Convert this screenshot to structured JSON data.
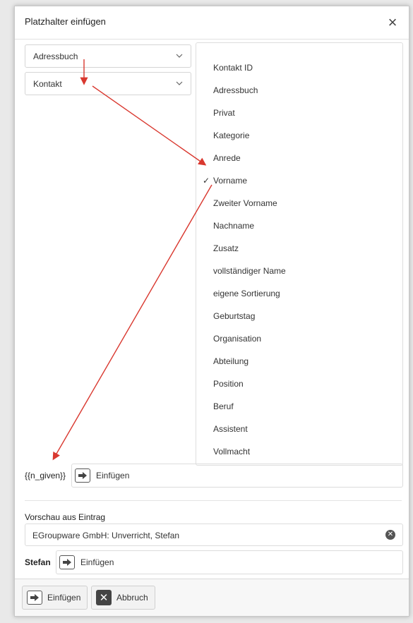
{
  "dialog": {
    "title": "Platzhalter einfügen",
    "close_glyph": "×"
  },
  "selects": {
    "app": "Adressbuch",
    "type": "Kontakt"
  },
  "fields": {
    "selected": "Vorname",
    "check_glyph": "✓",
    "items": [
      "Kontakt ID",
      "Adressbuch",
      "Privat",
      "Kategorie",
      "Anrede",
      "Vorname",
      "Zweiter Vorname",
      "Nachname",
      "Zusatz",
      "vollständiger Name",
      "eigene Sortierung",
      "Geburtstag",
      "Organisation",
      "Abteilung",
      "Position",
      "Beruf",
      "Assistent",
      "Vollmacht"
    ]
  },
  "placeholder": {
    "value": "{{n_given}}",
    "insert_label": "Einfügen"
  },
  "preview": {
    "label": "Vorschau aus Eintrag",
    "entry": "EGroupware GmbH: Unverricht, Stefan",
    "result": "Stefan",
    "insert_label": "Einfügen"
  },
  "footer": {
    "insert_label": "Einfügen",
    "cancel_label": "Abbruch"
  },
  "icons": {
    "chevron": "chevron-down-icon",
    "insert": "arrow-right-box-icon",
    "cancel": "x-box-icon",
    "clear": "clear-circle-icon",
    "close": "close-icon"
  },
  "colors": {
    "annotation_arrow": "#d9382f"
  }
}
